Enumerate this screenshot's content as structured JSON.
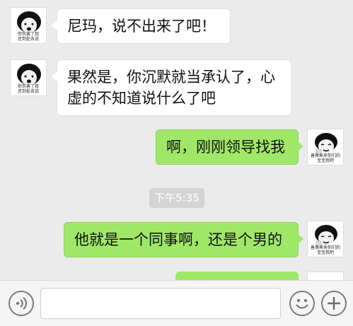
{
  "messages": [
    {
      "side": "left",
      "text": "尼玛，说不出来了吧！",
      "avatar_caption": "你伤害了我\n还到处去说",
      "avatar_icon": "meme-face-icon"
    },
    {
      "side": "left",
      "text": "果然是，你沉默就当承认了，心\n虚的不知道说什么了吧",
      "avatar_caption": "你伤害了我\n还到处去说",
      "avatar_icon": "meme-face-icon"
    },
    {
      "side": "right",
      "text": "啊，刚刚领导找我",
      "avatar_caption": "善良来来你们的\n宝宝我吧",
      "avatar_icon": "meme-face-icon"
    },
    {
      "side": "right",
      "text": "他就是一个同事啊，还是个男的",
      "avatar_caption": "善良来来你们的\n宝宝我吧",
      "avatar_icon": "meme-face-icon"
    }
  ],
  "timestamp": "下午5:35",
  "input": {
    "value": "",
    "placeholder": ""
  },
  "icons": {
    "voice": "voice-icon",
    "emoji": "emoji-icon",
    "more": "plus-icon"
  },
  "colors": {
    "background": "#ebebeb",
    "sent_bubble": "#9fe867",
    "received_bubble": "#ffffff"
  }
}
